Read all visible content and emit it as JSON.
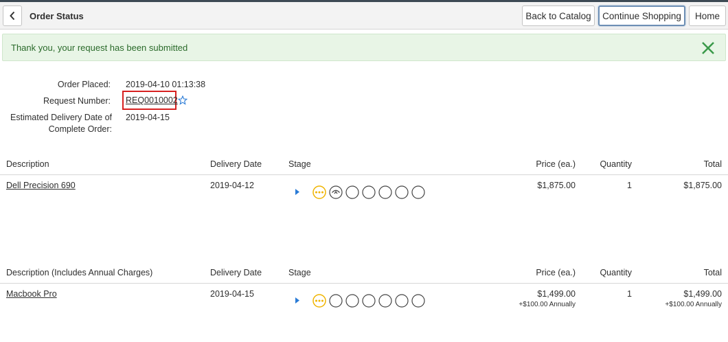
{
  "header": {
    "title": "Order Status",
    "back_catalog_label": "Back to Catalog",
    "continue_shopping_label": "Continue Shopping",
    "home_label": "Home"
  },
  "message": {
    "text": "Thank you, your request has been submitted"
  },
  "order_info": {
    "placed_label": "Order Placed:",
    "placed_value": "2019-04-10 01:13:38",
    "request_label": "Request Number:",
    "request_value": "REQ0010002",
    "delivery_label_line1": "Estimated Delivery Date of",
    "delivery_label_line2": "Complete Order:",
    "delivery_value": "2019-04-15"
  },
  "tables": [
    {
      "columns": {
        "description": "Description",
        "delivery": "Delivery Date",
        "stage": "Stage",
        "price": "Price (ea.)",
        "quantity": "Quantity",
        "total": "Total"
      },
      "row": {
        "description": "Dell Precision 690",
        "delivery": "2019-04-12",
        "price": "$1,875.00",
        "quantity": "1",
        "total": "$1,875.00"
      }
    },
    {
      "columns": {
        "description": "Description (Includes Annual Charges)",
        "delivery": "Delivery Date",
        "stage": "Stage",
        "price": "Price (ea.)",
        "quantity": "Quantity",
        "total": "Total"
      },
      "row": {
        "description": "Macbook Pro",
        "delivery": "2019-04-15",
        "price": "$1,499.00",
        "price_sub": "+$100.00 Annually",
        "quantity": "1",
        "total": "$1,499.00",
        "total_sub": "+$100.00 Annually"
      }
    }
  ],
  "colors": {
    "accent": "#f0b400",
    "success_bg": "#e8f5e6",
    "highlight": "#d62020",
    "link_blue": "#2a7bd6"
  },
  "icons": [
    "chevron-left-icon",
    "close-icon",
    "star-icon",
    "expand-arrow-icon",
    "stage-in-progress-icon",
    "stage-approval-icon",
    "stage-pending-icon"
  ]
}
